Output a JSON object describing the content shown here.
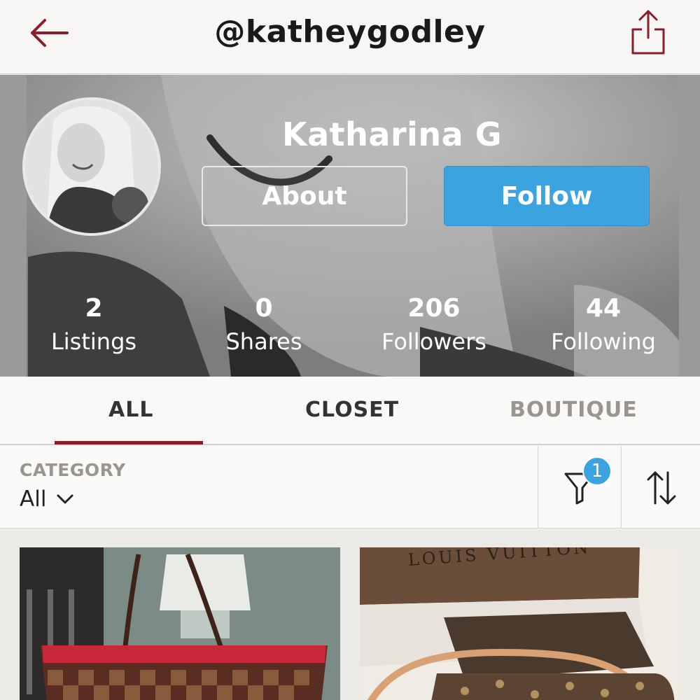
{
  "header": {
    "username": "@katheygodley"
  },
  "profile": {
    "display_name": "Katharina G",
    "about_label": "About",
    "follow_label": "Follow"
  },
  "stats": [
    {
      "value": "2",
      "label": "Listings"
    },
    {
      "value": "0",
      "label": "Shares"
    },
    {
      "value": "206",
      "label": "Followers"
    },
    {
      "value": "44",
      "label": "Following"
    }
  ],
  "tabs": [
    {
      "label": "ALL",
      "active": true
    },
    {
      "label": "CLOSET",
      "active": false
    },
    {
      "label": "BOUTIQUE",
      "active": false
    }
  ],
  "filter": {
    "category_label": "CATEGORY",
    "category_value": "All",
    "filter_count": "1"
  },
  "listings": [
    {
      "image": "damier-tote-bag-photo"
    },
    {
      "image": "louis-vuitton-bag-photo",
      "box_text": "LOUIS VUITTON"
    }
  ],
  "icons": {
    "back": "back-arrow-icon",
    "share": "share-icon",
    "filter": "filter-funnel-icon",
    "sort": "sort-arrows-icon",
    "chevron": "chevron-down-icon"
  },
  "colors": {
    "accent": "#8b1e2b",
    "follow_blue": "#3ba3e0",
    "tab_inactive": "#999591"
  }
}
